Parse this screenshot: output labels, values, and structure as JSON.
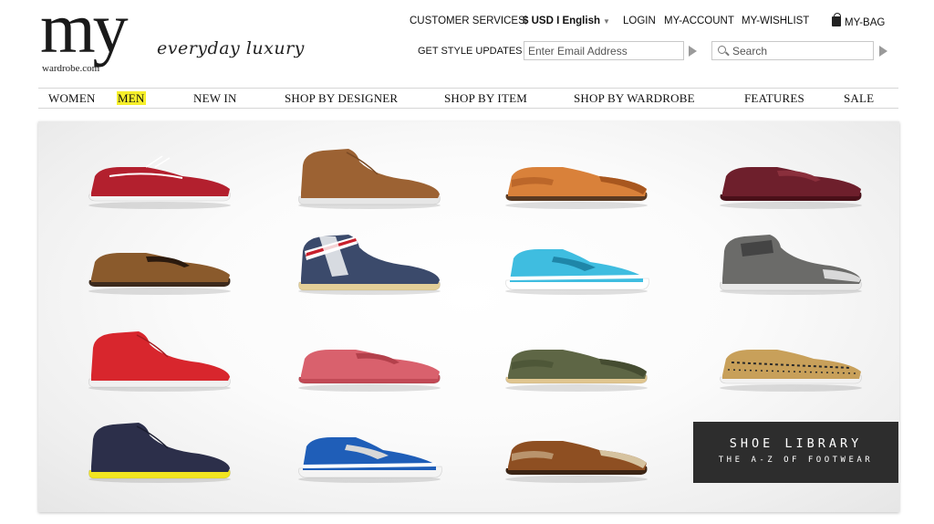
{
  "logo": {
    "wordmark": "my",
    "subtext": "wardrobe.com",
    "tagline": "everyday luxury"
  },
  "utility": {
    "customer_services": "CUSTOMER SERVICES",
    "currency_language": "$ USD I English",
    "login": "LOGIN",
    "account": "MY-ACCOUNT",
    "wishlist": "MY-WISHLIST",
    "bag": "MY-BAG"
  },
  "style_updates": {
    "label": "GET STYLE UPDATES",
    "placeholder": "Enter Email Address"
  },
  "search": {
    "placeholder": "Search"
  },
  "nav": {
    "items": [
      {
        "label": "WOMEN"
      },
      {
        "label": "MEN",
        "active": true
      },
      {
        "label": "NEW IN"
      },
      {
        "label": "SHOP BY DESIGNER"
      },
      {
        "label": "SHOP BY ITEM"
      },
      {
        "label": "SHOP BY WARDROBE"
      },
      {
        "label": "FEATURES"
      },
      {
        "label": "SALE"
      }
    ]
  },
  "shoe_library": {
    "title": "SHOE LIBRARY",
    "subtitle": "THE A-Z OF FOOTWEAR"
  },
  "shoes": [
    {
      "kind": "boat-shoe",
      "upper": "#b3202e",
      "sole": "#f2f2f2",
      "accent": "#ffffff"
    },
    {
      "kind": "chukka",
      "upper": "#9c6233",
      "sole": "#e6e6e6",
      "accent": "#7a4a24"
    },
    {
      "kind": "brogue",
      "upper": "#d9813a",
      "sole": "#5a3a22",
      "accent": "#a8571f"
    },
    {
      "kind": "loafer",
      "upper": "#6e1f2c",
      "sole": "#4a1019",
      "accent": "#8a2f3c"
    },
    {
      "kind": "loafer",
      "upper": "#8a5a2c",
      "sole": "#3d2a1c",
      "accent": "#2b1a0e"
    },
    {
      "kind": "union-jack-chukka",
      "upper": "#3b4a6b",
      "sole": "#e3cf98",
      "accent": "#c8202c"
    },
    {
      "kind": "sneaker",
      "upper": "#3fbde0",
      "sole": "#ffffff",
      "accent": "#1f86a8"
    },
    {
      "kind": "high-top",
      "upper": "#6b6b69",
      "sole": "#e9e9e9",
      "accent": "#444444"
    },
    {
      "kind": "chukka",
      "upper": "#d8262d",
      "sole": "#f0f0f0",
      "accent": "#a51b20"
    },
    {
      "kind": "driver",
      "upper": "#d9616d",
      "sole": "#c24a56",
      "accent": "#b3404b"
    },
    {
      "kind": "brogue",
      "upper": "#5e6645",
      "sole": "#e0c690",
      "accent": "#454c31"
    },
    {
      "kind": "slip-on",
      "upper": "#c8a05a",
      "sole": "#f2f2f2",
      "accent": "#2a2a2a"
    },
    {
      "kind": "chukka",
      "upper": "#2c2f4a",
      "sole": "#f2e520",
      "accent": "#1b1d30"
    },
    {
      "kind": "sneaker",
      "upper": "#1f5eb8",
      "sole": "#f4f4f4",
      "accent": "#d8d8d8"
    },
    {
      "kind": "brogue",
      "upper": "#8e4f22",
      "sole": "#3b2414",
      "accent": "#d6c3a0"
    }
  ]
}
